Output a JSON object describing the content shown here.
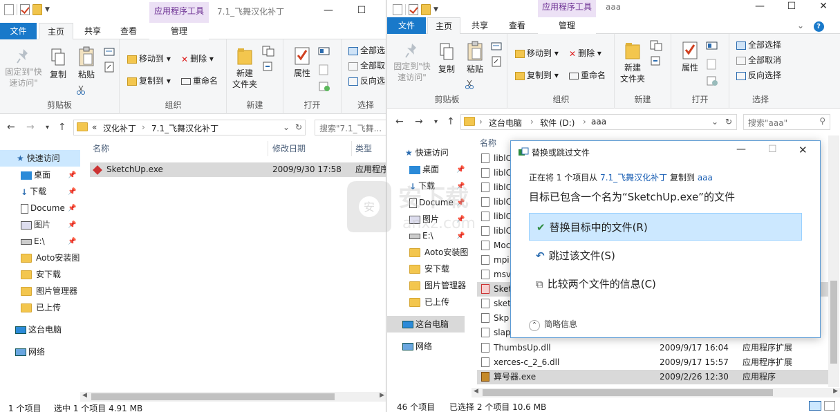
{
  "left": {
    "context_tab": "应用程序工具",
    "title": "7.1_飞舞汉化补丁",
    "tabs": [
      "文件",
      "主页",
      "共享",
      "查看",
      "管理"
    ],
    "ribbon": {
      "clipboard": {
        "pin": "固定到\"快速访问\"",
        "copy": "复制",
        "paste": "粘贴",
        "label": "剪贴板"
      },
      "organize": {
        "move": "移动到",
        "copyto": "复制到",
        "delete": "删除",
        "rename": "重命名",
        "label": "组织"
      },
      "new": {
        "newfolder": "新建\n文件夹",
        "label": "新建"
      },
      "open": {
        "props": "属性",
        "label": "打开"
      },
      "select": {
        "all": "全部选",
        "none": "全部取",
        "invert": "反向选",
        "label": "选择"
      }
    },
    "address": {
      "crumb1": "«",
      "crumb2": "汉化补丁",
      "crumb3": "7.1_飞舞汉化补丁",
      "search": "搜索\"7.1_飞舞..."
    },
    "nav": {
      "quick": "快速访问",
      "items": [
        "桌面",
        "下载",
        "Docume",
        "图片",
        "E:\\",
        "Aoto安装图",
        "安下载",
        "图片管理器",
        "已上传"
      ],
      "pc": "这台电脑",
      "net": "网络"
    },
    "columns": {
      "name": "名称",
      "date": "修改日期",
      "type": "类型"
    },
    "rows": [
      {
        "name": "SketchUp.exe",
        "date": "2009/9/30 17:58",
        "type": "应用程序"
      }
    ],
    "status": {
      "count": "1 个项目",
      "selected": "选中 1 个项目 4.91 MB"
    }
  },
  "right": {
    "context_tab": "应用程序工具",
    "title": "aaa",
    "tabs": [
      "文件",
      "主页",
      "共享",
      "查看",
      "管理"
    ],
    "ribbon": {
      "clipboard": {
        "pin": "固定到\"快速访问\"",
        "copy": "复制",
        "paste": "粘贴",
        "label": "剪贴板"
      },
      "organize": {
        "move": "移动到",
        "copyto": "复制到",
        "delete": "删除",
        "rename": "重命名",
        "label": "组织"
      },
      "new": {
        "newfolder": "新建\n文件夹",
        "label": "新建"
      },
      "open": {
        "props": "属性",
        "label": "打开"
      },
      "select": {
        "all": "全部选择",
        "none": "全部取消",
        "invert": "反向选择",
        "label": "选择"
      }
    },
    "address": {
      "crumb1": "这台电脑",
      "crumb2": "软件 (D:)",
      "crumb3": "aaa",
      "search": "搜索\"aaa\""
    },
    "nav": {
      "quick": "快速访问",
      "items": [
        "桌面",
        "下载",
        "Docume",
        "图片",
        "E:\\",
        "Aoto安装图",
        "安下载",
        "图片管理器",
        "已上传"
      ],
      "pc": "这台电脑",
      "net": "网络"
    },
    "columns": {
      "name": "名称"
    },
    "rows": [
      {
        "name": "liblC",
        "date": "",
        "type": ""
      },
      {
        "name": "liblC",
        "date": "",
        "type": ""
      },
      {
        "name": "liblC",
        "date": "",
        "type": ""
      },
      {
        "name": "liblC",
        "date": "",
        "type": ""
      },
      {
        "name": "liblC",
        "date": "",
        "type": ""
      },
      {
        "name": "liblC",
        "date": "",
        "type": ""
      },
      {
        "name": "Moc",
        "date": "",
        "type": ""
      },
      {
        "name": "mpi",
        "date": "",
        "type": ""
      },
      {
        "name": "msv",
        "date": "",
        "type": ""
      },
      {
        "name": "Sket",
        "date": "",
        "type": ""
      },
      {
        "name": "sket",
        "date": "",
        "type": ""
      },
      {
        "name": "Skp",
        "date": "",
        "type": ""
      },
      {
        "name": "slap",
        "date": "",
        "type": ""
      },
      {
        "name": "ThumbsUp.dll",
        "date": "2009/9/17 16:04",
        "type": "应用程序扩展"
      },
      {
        "name": "xerces-c_2_6.dll",
        "date": "2009/9/17 15:57",
        "type": "应用程序扩展"
      },
      {
        "name": "算号器.exe",
        "date": "2009/2/26 12:30",
        "type": "应用程序"
      }
    ],
    "status": {
      "count": "46 个项目",
      "selected": "已选择 2 个项目  10.6 MB"
    }
  },
  "dialog": {
    "title": "替换或跳过文件",
    "line_prefix": "正在将 1 个项目从 ",
    "src": "7.1_飞舞汉化补丁",
    "mid": " 复制到 ",
    "dst": "aaa",
    "heading": "目标已包含一个名为“SketchUp.exe”的文件",
    "opt_replace": "替换目标中的文件(R)",
    "opt_skip": "跳过该文件(S)",
    "opt_compare": "比较两个文件的信息(C)",
    "details": "简略信息"
  },
  "watermark": {
    "text": "安下载",
    "sub": "anxz.com"
  }
}
